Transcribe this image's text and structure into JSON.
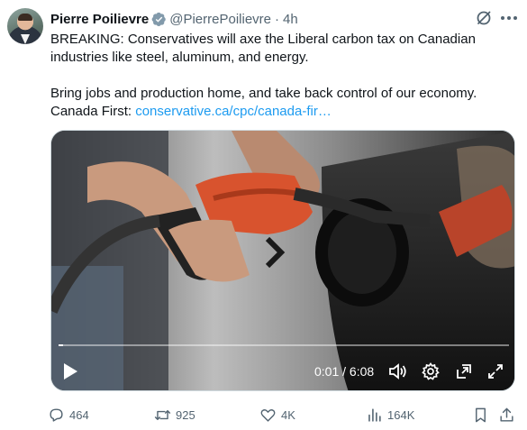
{
  "author": {
    "name": "Pierre Poilievre",
    "handle": "@PierrePoilievre",
    "separator": "·",
    "time": "4h"
  },
  "tweet": {
    "line1": "BREAKING: Conservatives will axe the Liberal carbon tax on Canadian industries like steel, aluminum, and energy.",
    "line2": "Bring jobs and production home, and take back control of our economy. Canada First:",
    "link": "conservative.ca/cpc/canada-fir…"
  },
  "video": {
    "timecode": "0:01 / 6:08",
    "progress": 0.003
  },
  "actions": {
    "replies": "464",
    "reposts": "925",
    "likes": "4K",
    "views": "164K"
  },
  "icons": {
    "verified": "verified-badge-icon",
    "grok": "grok-icon",
    "more": "more-icon",
    "play": "play-icon",
    "volume": "volume-icon",
    "settings": "gear-icon",
    "pip": "pip-icon",
    "fullscreen": "fullscreen-icon",
    "reply": "reply-icon",
    "retweet": "retweet-icon",
    "like": "heart-icon",
    "views": "views-icon",
    "bookmark": "bookmark-icon",
    "share": "share-icon"
  },
  "colors": {
    "link": "#1d9bf0",
    "verified": "#829aab",
    "muted": "#536471",
    "nozzle": "#d8532e"
  }
}
